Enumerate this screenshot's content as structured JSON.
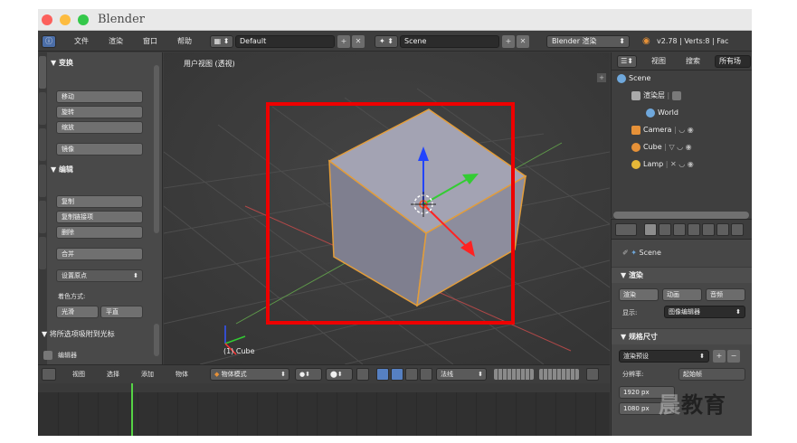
{
  "window": {
    "title": "Blender"
  },
  "infobar": {
    "menus": [
      "文件",
      "渲染",
      "窗口",
      "帮助"
    ],
    "screen_layout": "Default",
    "scene": "Scene",
    "engine": "Blender 渲染",
    "version": "v2.78 | Verts:8 | Fac"
  },
  "tool_shelf": {
    "transform": {
      "header": "▼ 变换",
      "buttons": [
        "移动",
        "旋转",
        "缩放",
        "镜像"
      ]
    },
    "edit": {
      "header": "▼ 编辑",
      "buttons": [
        "复制",
        "复制链接项",
        "删除",
        "合并"
      ],
      "set_origin": "设置原点",
      "shading_label": "着色方式:",
      "shading_smooth": "光滑",
      "shading_flat": "平直"
    },
    "operator_panel": "▼ 将所选项吸附到光标",
    "edit_mode_item": "编辑器"
  },
  "viewport": {
    "view_label": "用户视图 (透视)",
    "object_label": "(1) Cube"
  },
  "viewport_header": {
    "menus": [
      "视图",
      "选择",
      "添加",
      "物体"
    ],
    "mode": "物体模式",
    "orientation": "法线"
  },
  "outliner": {
    "header_items": [
      "视图",
      "搜索",
      "所有场"
    ],
    "tree": [
      {
        "label": "Scene",
        "indent": 0,
        "icon_color": "#6fa8dc"
      },
      {
        "label": "渲染层",
        "indent": 1,
        "icon_color": "#aaaaaa"
      },
      {
        "label": "World",
        "indent": 1,
        "icon_color": "#6fa8dc"
      },
      {
        "label": "Camera",
        "indent": 1,
        "icon_color": "#e69138"
      },
      {
        "label": "Cube",
        "indent": 1,
        "icon_color": "#e69138"
      },
      {
        "label": "Lamp",
        "indent": 1,
        "icon_color": "#e6b838"
      }
    ]
  },
  "properties": {
    "scene_label": "Scene",
    "render_section": "▼ 渲染",
    "render_buttons": [
      "渲染",
      "动画",
      "音频"
    ],
    "display_label": "显示:",
    "display_value": "图像编辑器",
    "dimensions_section": "▼ 规格尺寸",
    "render_presets": "渲染预设",
    "resolution_label": "分辨率:",
    "resolution_x": "1920 px",
    "resolution_y": "1080 px",
    "frame_range_hint": "起始帧"
  },
  "watermark": {
    "text_light": "晨",
    "text_dark": "教育"
  }
}
